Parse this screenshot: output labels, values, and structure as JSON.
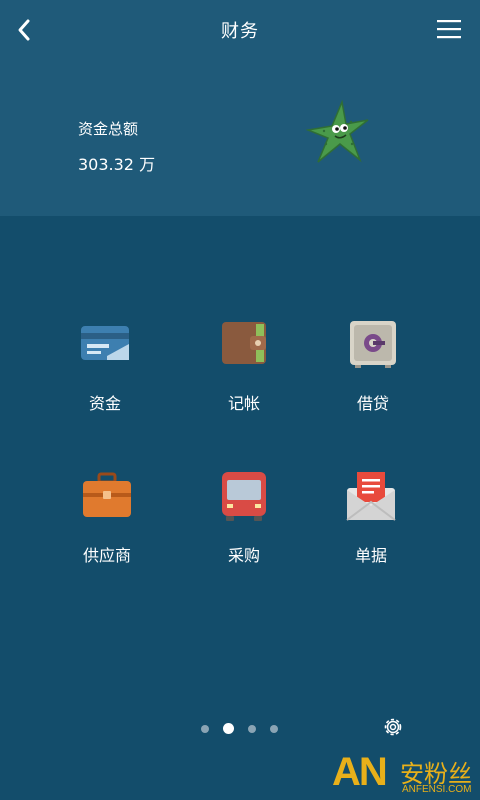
{
  "header": {
    "title": "财务",
    "back_icon": "back-chevron-icon",
    "menu_icon": "hamburger-menu-icon"
  },
  "summary": {
    "label": "资金总额",
    "value": "303.32 万",
    "mascot_icon": "starfish-mascot-icon"
  },
  "grid": {
    "items": [
      {
        "label": "资金",
        "icon": "bank-card-icon"
      },
      {
        "label": "记帐",
        "icon": "wallet-icon"
      },
      {
        "label": "借贷",
        "icon": "safe-icon"
      },
      {
        "label": "供应商",
        "icon": "briefcase-icon"
      },
      {
        "label": "采购",
        "icon": "bus-icon"
      },
      {
        "label": "单据",
        "icon": "envelope-document-icon"
      }
    ]
  },
  "pager": {
    "total": 4,
    "active_index": 1
  },
  "footer": {
    "settings_icon": "gear-icon"
  },
  "watermark": {
    "logo": "AN",
    "text_cn": "安粉丝",
    "text_en": "ANFENSI.COM"
  },
  "colors": {
    "background": "#134d6b",
    "header": "#1f5a79",
    "watermark": "#e8b01a"
  }
}
